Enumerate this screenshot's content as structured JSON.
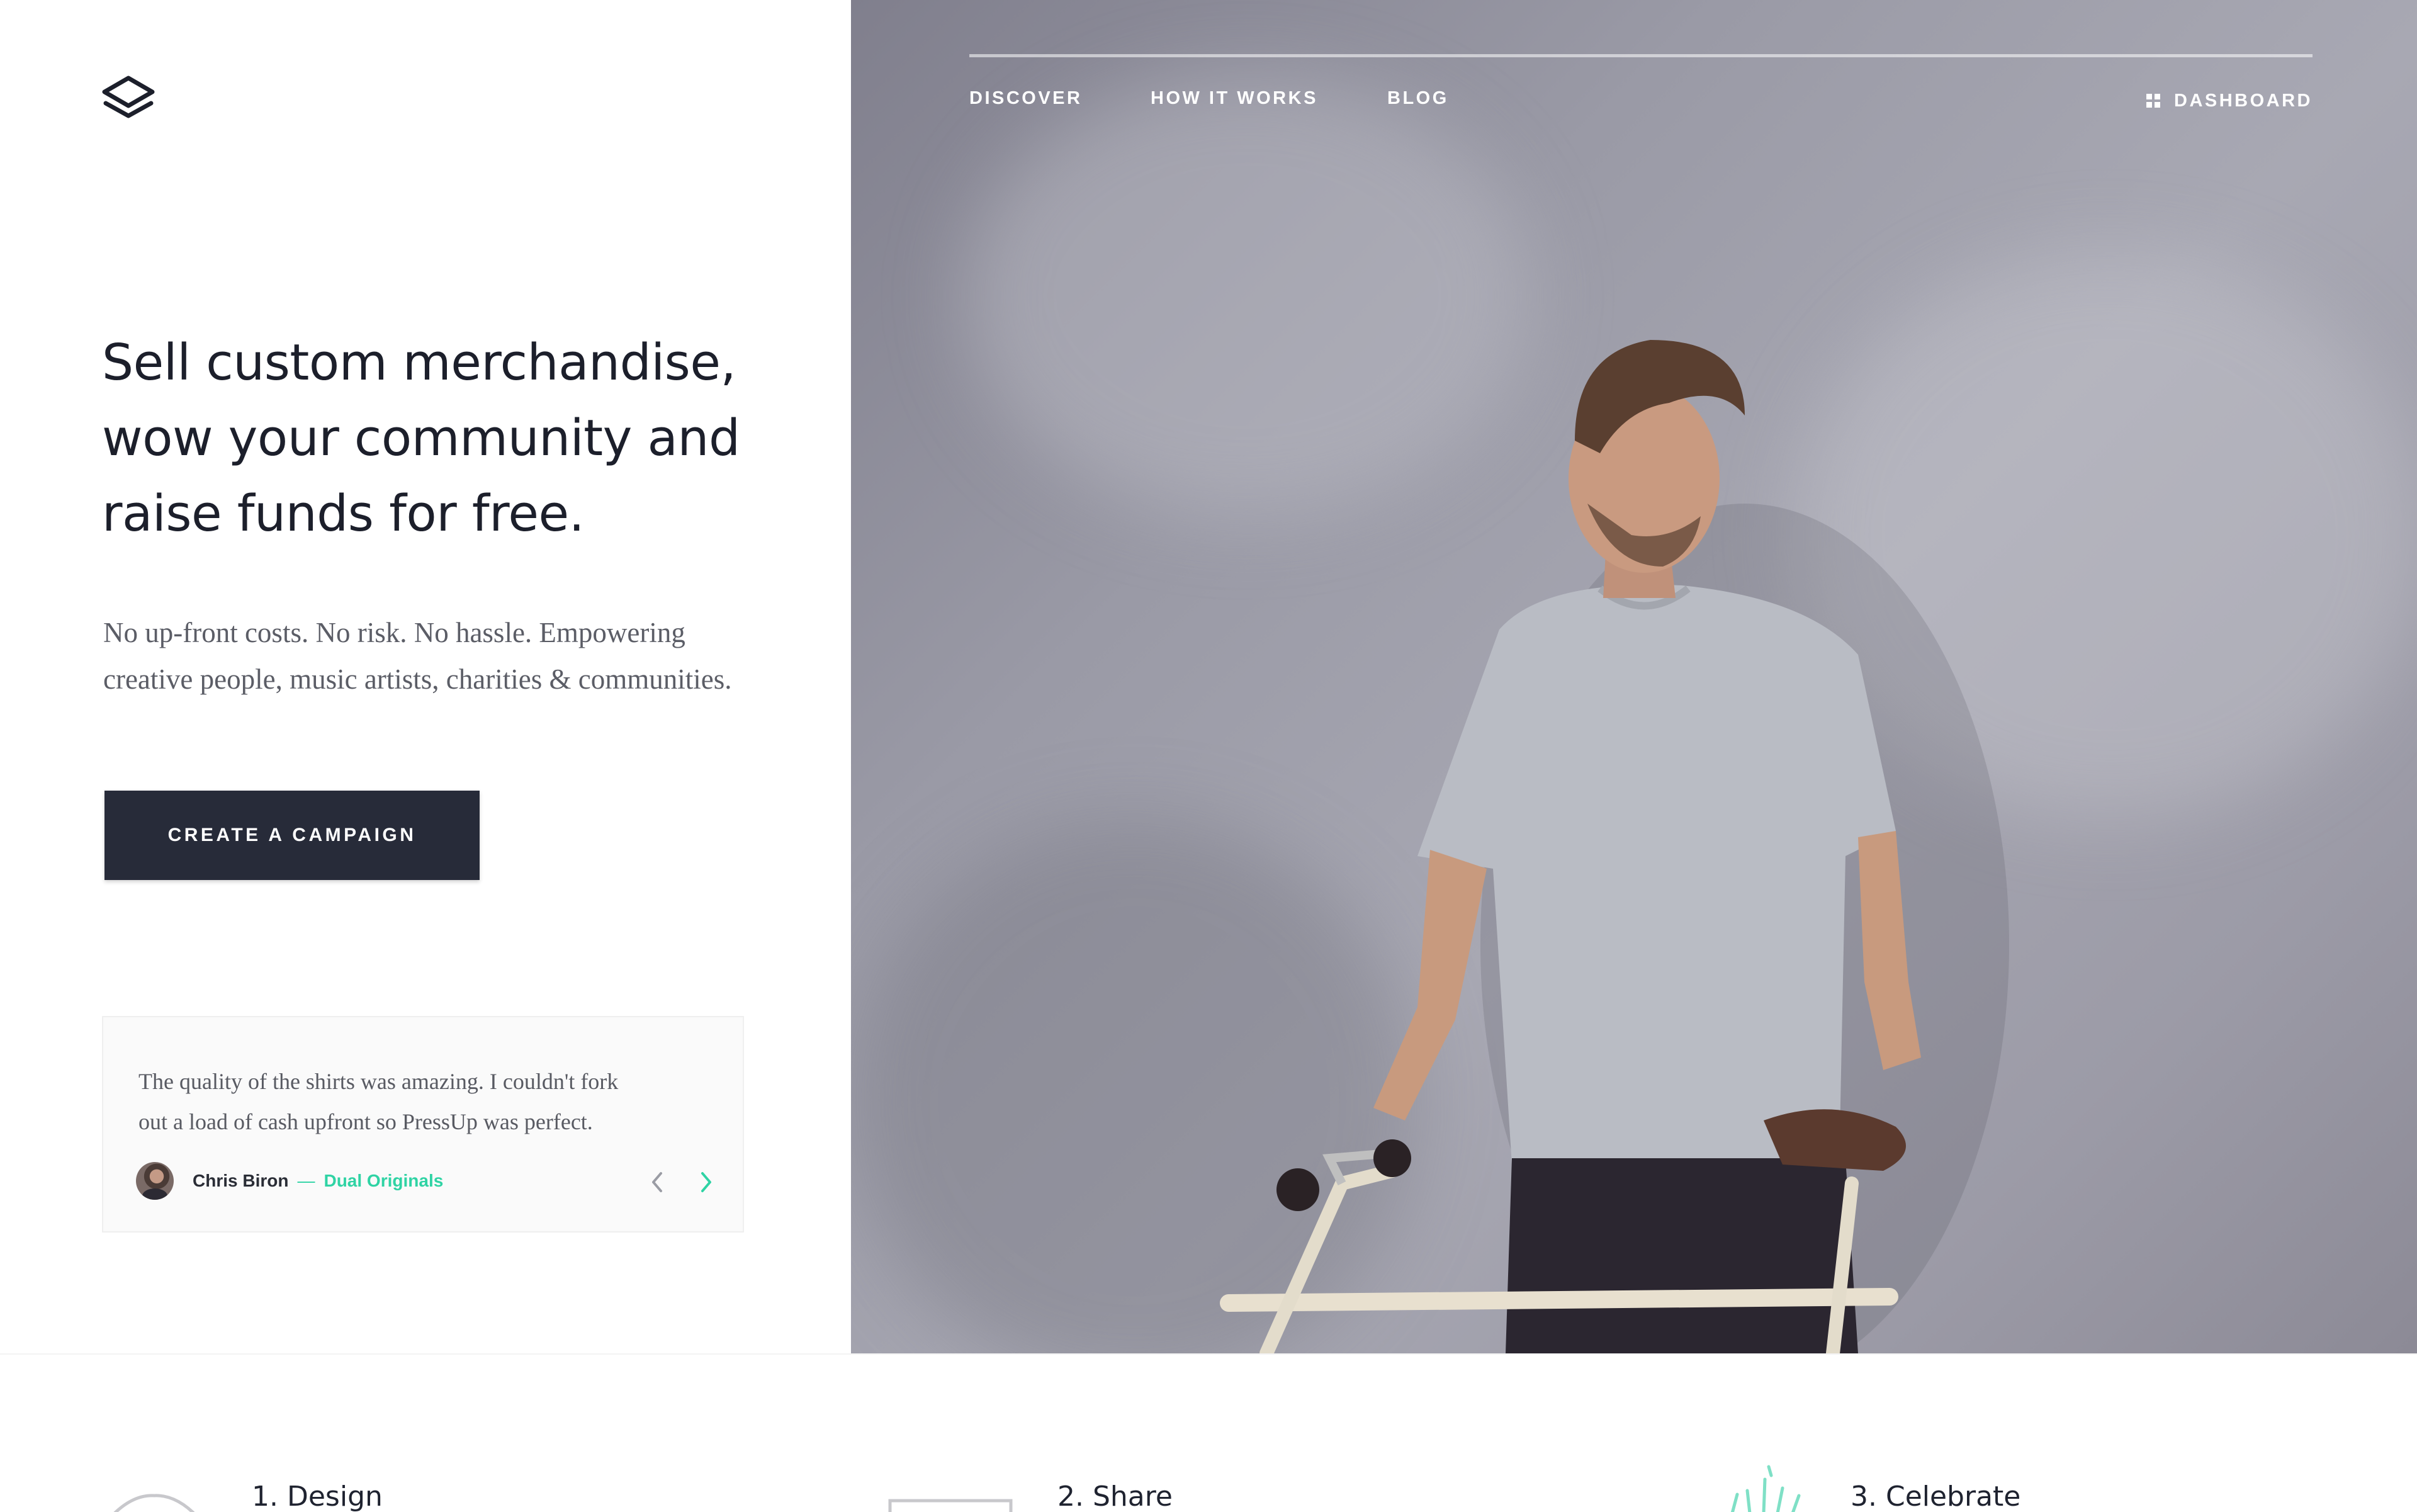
{
  "brand": {
    "logo_icon": "stack-layers-icon"
  },
  "nav": {
    "items": [
      "DISCOVER",
      "HOW IT WORKS",
      "BLOG"
    ],
    "dashboard": {
      "label": "DASHBOARD",
      "icon": "grid-icon"
    }
  },
  "hero": {
    "headline": [
      "Sell custom merchandise,",
      "wow your community and",
      "raise funds for free."
    ],
    "subcopy": [
      "No up-front costs. No risk. No hassle. Empowering",
      "creative people, music artists, charities & communities."
    ],
    "cta_label": "CREATE A CAMPAIGN"
  },
  "testimonial": {
    "quote": [
      "The quality of the shirts was amazing. I couldn't fork",
      "out a load of cash upfront so PressUp was perfect."
    ],
    "author": "Chris Biron",
    "separator": "—",
    "organization": "Dual Originals",
    "prev_icon": "chevron-left-icon",
    "next_icon": "chevron-right-icon"
  },
  "steps": [
    {
      "label": "1. Design",
      "icon": "tshirt-icon"
    },
    {
      "label": "2. Share",
      "icon": "card-icon"
    },
    {
      "label": "3. Celebrate",
      "icon": "confetti-icon"
    }
  ],
  "colors": {
    "button_bg": "#272b39",
    "accent_green": "#2fd3a4",
    "headline": "#1c1f2b",
    "body_text": "#5b5d66"
  }
}
